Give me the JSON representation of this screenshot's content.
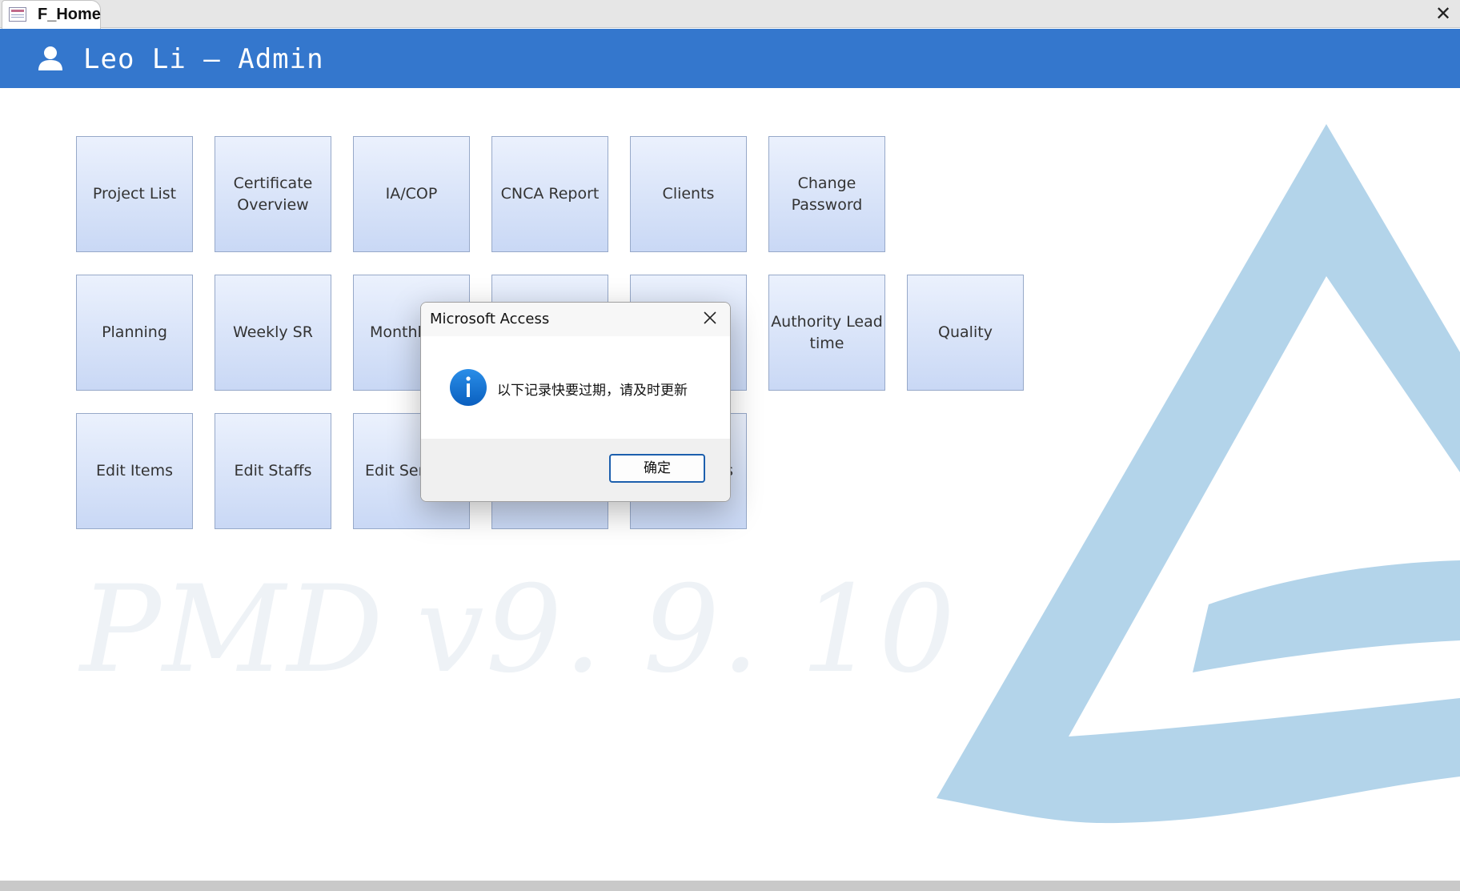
{
  "tab": {
    "title": "F_Home"
  },
  "header": {
    "user_title": "Leo Li – Admin"
  },
  "tiles": [
    {
      "label": "Project List"
    },
    {
      "label": "Certificate\nOverview"
    },
    {
      "label": "IA/COP"
    },
    {
      "label": "CNCA Report"
    },
    {
      "label": "Clients"
    },
    {
      "label": "Change\nPassword"
    },
    {
      "label": "Planning"
    },
    {
      "label": "Weekly SR"
    },
    {
      "label": "Monthly"
    },
    {
      "label": ""
    },
    {
      "label": ""
    },
    {
      "label": "Authority Lead\ntime"
    },
    {
      "label": "Quality"
    },
    {
      "label": "Edit Items"
    },
    {
      "label": "Edit Staffs"
    },
    {
      "label": "Edit Ser"
    },
    {
      "label": ""
    },
    {
      "label": "s"
    }
  ],
  "watermark": {
    "name": "PMD",
    "version": "v9. 9. 10"
  },
  "dialog": {
    "title": "Microsoft Access",
    "message": "以下记录快要过期，请及时更新",
    "ok_label": "确定",
    "icon": "info-icon"
  },
  "colors": {
    "header": "#3477cd",
    "logo": "#b3d4ea",
    "tile_top": "#ebf1fd",
    "tile_bottom": "#c9d8f5"
  }
}
